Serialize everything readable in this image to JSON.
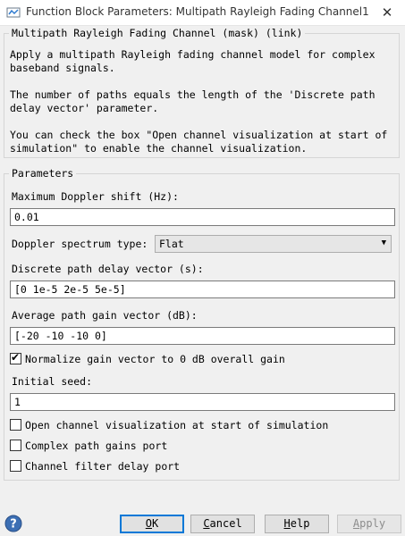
{
  "window": {
    "title": "Function Block Parameters: Multipath Rayleigh Fading Channel1",
    "close_glyph": "✕",
    "app_icon": "simulink-block-icon"
  },
  "mask": {
    "legend": "Multipath Rayleigh Fading Channel (mask) (link)",
    "para1": "Apply a multipath Rayleigh fading channel model for complex\nbaseband signals.",
    "para2": "The number of paths equals the length of the 'Discrete path\ndelay vector' parameter.",
    "para3": "You can check the box \"Open channel visualization at start of\nsimulation\" to enable the channel visualization."
  },
  "params": {
    "legend": "Parameters",
    "doppler_label": "Maximum Doppler shift (Hz):",
    "doppler_value": "0.01",
    "spectrum_label": "Doppler spectrum type:",
    "spectrum_value": "Flat",
    "delay_label": "Discrete path delay vector (s):",
    "delay_value": "[0 1e-5 2e-5 5e-5]",
    "gain_label": "Average path gain vector (dB):",
    "gain_value": "[-20 -10 -10 0]",
    "normalize_label": "Normalize gain vector to 0 dB overall gain",
    "normalize_checked": true,
    "seed_label": "Initial seed:",
    "seed_value": "1",
    "visualize_label": "Open channel visualization at start of simulation",
    "visualize_checked": false,
    "gains_port_label": "Complex path gains port",
    "gains_port_checked": false,
    "delay_port_label": "Channel filter delay port",
    "delay_port_checked": false
  },
  "buttons": {
    "ok": {
      "mnemonic": "O",
      "rest": "K"
    },
    "cancel": {
      "mnemonic": "C",
      "rest": "ancel"
    },
    "help": {
      "mnemonic": "H",
      "rest": "elp"
    },
    "apply": {
      "mnemonic": "A",
      "rest": "pply"
    },
    "help_icon": "help-question-icon"
  },
  "colors": {
    "accent": "#0078d7",
    "help_icon": "#3c6fb4"
  }
}
